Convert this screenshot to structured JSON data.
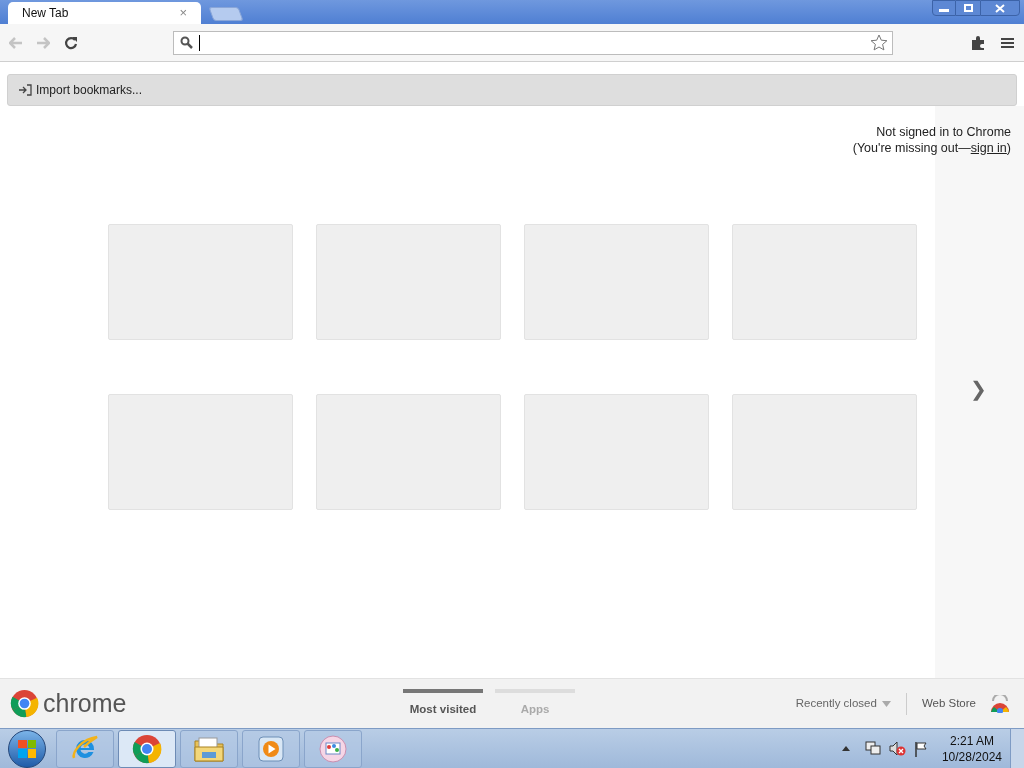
{
  "tabs": [
    {
      "label": "New Tab",
      "selected": true,
      "close": "×"
    }
  ],
  "bookmark_bar": {
    "import": "Import bookmarks..."
  },
  "sign_in": {
    "line1": "Not signed in to Chrome",
    "prefix": "(You're missing out—",
    "link": "sign in",
    "suffix": ")"
  },
  "tiles": [
    {
      "kind": "empty"
    },
    {
      "kind": "empty"
    },
    {
      "kind": "empty"
    },
    {
      "kind": "empty"
    },
    {
      "kind": "empty"
    },
    {
      "kind": "empty"
    },
    {
      "kind": "empty"
    },
    {
      "kind": "empty"
    }
  ],
  "next_page": "❯",
  "footer": {
    "logo": "chrome",
    "sections": [
      {
        "label": "Most visited",
        "selected": true
      },
      {
        "label": "Apps",
        "selected": false
      }
    ],
    "recently_closed": "Recently closed",
    "web_store": "Web Store"
  },
  "taskbar": {
    "apps": [
      {
        "kind": "ie",
        "selected": false
      },
      {
        "kind": "chrome",
        "selected": true
      },
      {
        "kind": "folder",
        "selected": false
      },
      {
        "kind": "media",
        "selected": false
      },
      {
        "kind": "paint",
        "selected": false
      }
    ],
    "time": "2:21 AM",
    "date": "10/28/2024"
  }
}
